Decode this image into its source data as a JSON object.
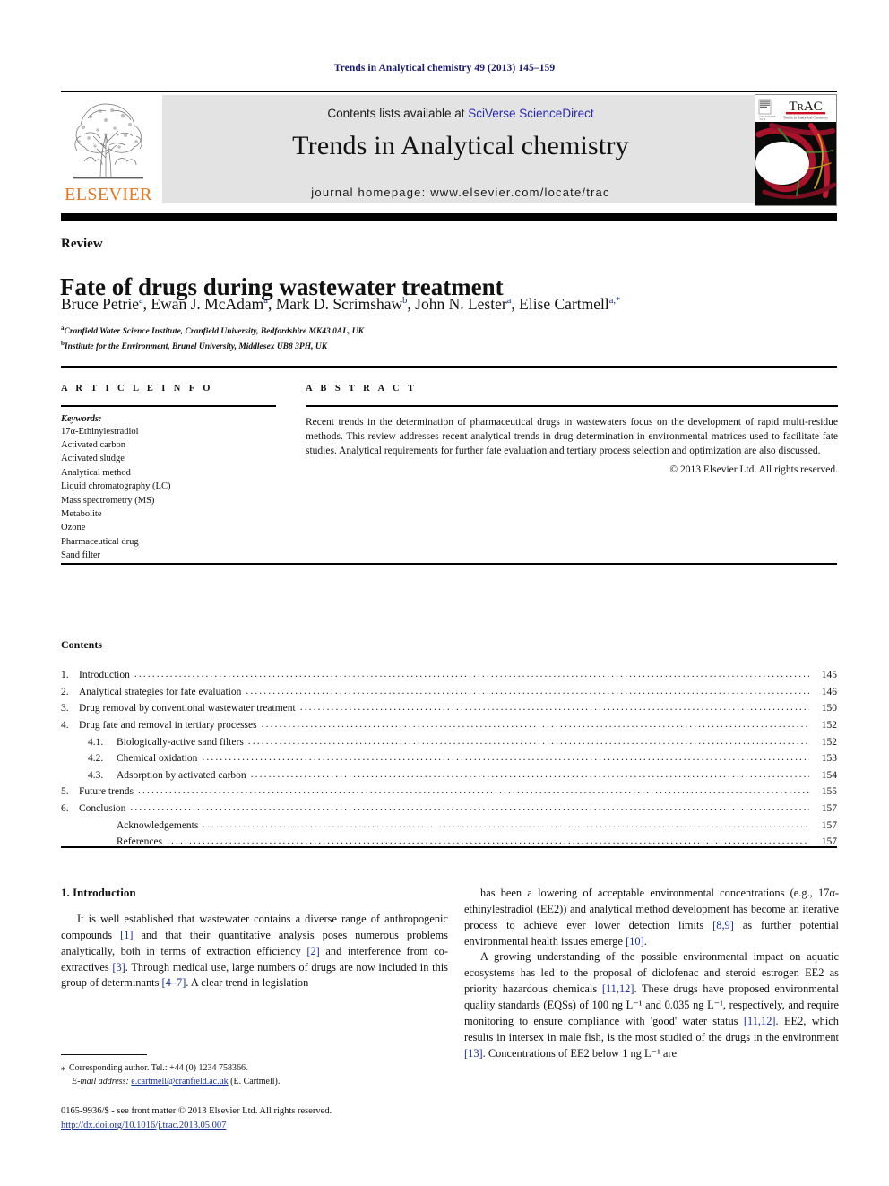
{
  "running_head": "Trends in Analytical chemistry 49 (2013) 145–159",
  "masthead": {
    "publisher_name": "ELSEVIER",
    "contents_prefix": "Contents lists available at ",
    "sciencedirect_link": "SciVerse ScienceDirect",
    "journal_name": "Trends in Analytical chemistry",
    "homepage": "journal homepage: www.elsevier.com/locate/trac",
    "cover_title": "TrAC",
    "cover_subtitle": "Trends in Analytical Chemistry"
  },
  "article": {
    "type_label": "Review",
    "title": "Fate of drugs during wastewater treatment",
    "authors": [
      {
        "name": "Bruce Petrie",
        "marks": "a"
      },
      {
        "name": "Ewan J. McAdam",
        "marks": "a"
      },
      {
        "name": "Mark D. Scrimshaw",
        "marks": "b"
      },
      {
        "name": "John N. Lester",
        "marks": "a"
      },
      {
        "name": "Elise Cartmell",
        "marks": "a,*"
      }
    ],
    "affiliations": [
      {
        "mark": "a",
        "text": "Cranfield Water Science Institute, Cranfield University, Bedfordshire MK43 0AL, UK"
      },
      {
        "mark": "b",
        "text": "Institute for the Environment, Brunel University, Middlesex UB8 3PH, UK"
      }
    ]
  },
  "article_info": {
    "heading": "A R T I C L E   I N F O",
    "keywords_label": "Keywords:",
    "keywords": [
      "17α-Ethinylestradiol",
      "Activated carbon",
      "Activated sludge",
      "Analytical method",
      "Liquid chromatography (LC)",
      "Mass spectrometry (MS)",
      "Metabolite",
      "Ozone",
      "Pharmaceutical drug",
      "Sand filter"
    ]
  },
  "abstract": {
    "heading": "A B S T R A C T",
    "text": "Recent trends in the determination of pharmaceutical drugs in wastewaters focus on the development of rapid multi-residue methods. This review addresses recent analytical trends in drug determination in environmental matrices used to facilitate fate studies. Analytical requirements for further fate evaluation and tertiary process selection and optimization are also discussed.",
    "copyright": "© 2013 Elsevier Ltd. All rights reserved."
  },
  "contents": {
    "heading": "Contents",
    "entries": [
      {
        "num": "1.",
        "label": "Introduction",
        "page": "145",
        "level": 1
      },
      {
        "num": "2.",
        "label": "Analytical strategies for fate evaluation",
        "page": "146",
        "level": 1
      },
      {
        "num": "3.",
        "label": "Drug removal by conventional wastewater treatment",
        "page": "150",
        "level": 1
      },
      {
        "num": "4.",
        "label": "Drug fate and removal in tertiary processes",
        "page": "152",
        "level": 1
      },
      {
        "num": "4.1.",
        "label": "Biologically-active sand filters",
        "page": "152",
        "level": 2
      },
      {
        "num": "4.2.",
        "label": "Chemical oxidation",
        "page": "153",
        "level": 2
      },
      {
        "num": "4.3.",
        "label": "Adsorption by activated carbon",
        "page": "154",
        "level": 2
      },
      {
        "num": "5.",
        "label": "Future trends",
        "page": "155",
        "level": 1
      },
      {
        "num": "6.",
        "label": "Conclusion",
        "page": "157",
        "level": 1
      },
      {
        "num": "",
        "label": "Acknowledgements",
        "page": "157",
        "level": 2
      },
      {
        "num": "",
        "label": "References",
        "page": "157",
        "level": 2
      }
    ]
  },
  "body": {
    "section_heading": "1. Introduction",
    "left_paragraphs": [
      "It is well established that wastewater contains a diverse range of anthropogenic compounds [1] and that their quantitative analysis poses numerous problems analytically, both in terms of extraction efficiency [2] and interference from co-extractives [3]. Through medical use, large numbers of drugs are now included in this group of determinants [4–7]. A clear trend in legislation"
    ],
    "right_paragraphs": [
      "has been a lowering of acceptable environmental concentrations (e.g., 17α-ethinylestradiol (EE2)) and analytical method development has become an iterative process to achieve ever lower detection limits [8,9] as further potential environmental health issues emerge [10].",
      "A growing understanding of the possible environmental impact on aquatic ecosystems has led to the proposal of diclofenac and steroid estrogen EE2 as priority hazardous chemicals [11,12]. These drugs have proposed environmental quality standards (EQSs) of 100 ng L⁻¹ and 0.035 ng L⁻¹, respectively, and require monitoring to ensure compliance with 'good' water status [11,12]. EE2, which results in intersex in male fish, is the most studied of the drugs in the environment [13]. Concentrations of EE2 below 1 ng L⁻¹ are"
    ]
  },
  "footnotes": {
    "corresponding": "Corresponding author. Tel.: +44 (0) 1234 758366.",
    "email_label": "E-mail address:",
    "email": "e.cartmell@cranfield.ac.uk",
    "email_owner": "(E. Cartmell).",
    "issn_line": "0165-9936/$ - see front matter © 2013 Elsevier Ltd. All rights reserved.",
    "doi": "http://dx.doi.org/10.1016/j.trac.2013.05.007"
  }
}
